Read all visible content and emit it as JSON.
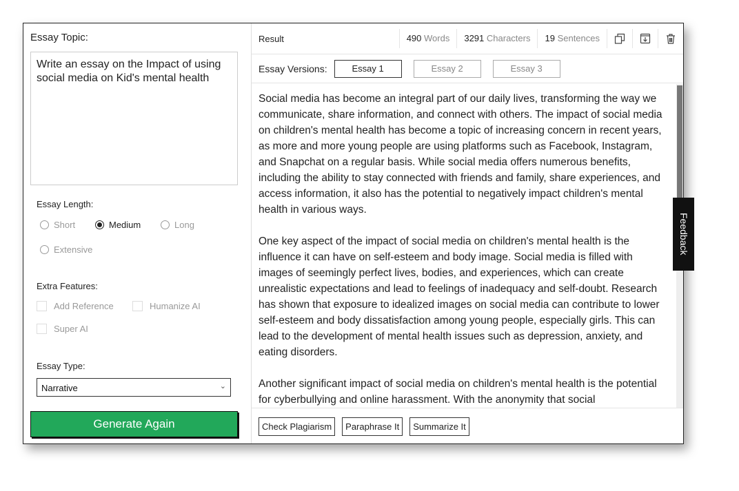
{
  "left": {
    "topic_label": "Essay Topic:",
    "topic_value": "Write an essay on the Impact of using social media on Kid's mental health",
    "length_label": "Essay Length:",
    "lengths": [
      {
        "label": "Short",
        "selected": false
      },
      {
        "label": "Medium",
        "selected": true
      },
      {
        "label": "Long",
        "selected": false
      },
      {
        "label": "Extensive",
        "selected": false
      }
    ],
    "features_label": "Extra Features:",
    "features": [
      {
        "label": "Add Reference",
        "checked": false
      },
      {
        "label": "Humanize AI",
        "checked": false
      },
      {
        "label": "Super AI",
        "checked": false
      }
    ],
    "type_label": "Essay Type:",
    "type_value": "Narrative",
    "generate_label": "Generate Again",
    "generate_color": "#22a85a"
  },
  "right": {
    "title": "Result",
    "words": "490",
    "words_unit": "Words",
    "chars": "3291",
    "chars_unit": "Characters",
    "sentences": "19",
    "sentences_unit": "Sentences",
    "icons": [
      "copy-icon",
      "download-icon",
      "trash-icon"
    ],
    "versions_label": "Essay Versions:",
    "versions": [
      "Essay 1",
      "Essay 2",
      "Essay 3"
    ],
    "active_version": "Essay 1",
    "paragraphs": [
      "Social media has become an integral part of our daily lives, transforming the way we communicate, share information, and connect with others. The impact of social media on children's mental health has become a topic of increasing concern in recent years, as more and more young people are using platforms such as Facebook, Instagram, and Snapchat on a regular basis. While social media offers numerous benefits, including the ability to stay connected with friends and family, share experiences, and access information, it also has the potential to negatively impact children's mental health in various ways.",
      "One key aspect of the impact of social media on children's mental health is the influence it can have on self-esteem and body image. Social media is filled with images of seemingly perfect lives, bodies, and experiences, which can create unrealistic expectations and lead to feelings of inadequacy and self-doubt. Research has shown that exposure to idealized images on social media can contribute to lower self-esteem and body dissatisfaction among young people, especially girls. This can lead to the development of mental health issues such as depression, anxiety, and eating disorders.",
      "Another significant impact of social media on children's mental health is the potential for cyberbullying and online harassment. With the anonymity that social"
    ],
    "actions": [
      "Check Plagiarism",
      "Paraphrase It",
      "Summarize It"
    ]
  },
  "feedback_label": "Feedback"
}
